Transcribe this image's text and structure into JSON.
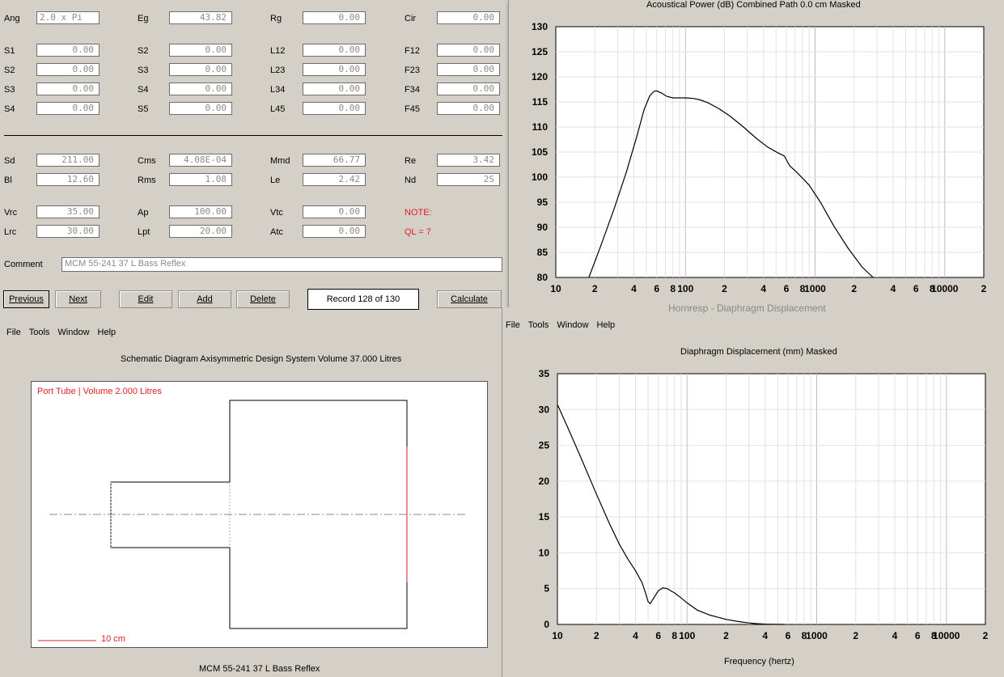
{
  "params": {
    "row0": [
      {
        "label": "Ang",
        "value": "2.0 x Pi"
      },
      {
        "label": "Eg",
        "value": "43.82"
      },
      {
        "label": "Rg",
        "value": "0.00"
      },
      {
        "label": "Cir",
        "value": "0.00"
      }
    ],
    "row1": [
      {
        "label": "S1",
        "value": "0.00"
      },
      {
        "label": "S2",
        "value": "0.00"
      },
      {
        "label": "L12",
        "value": "0.00"
      },
      {
        "label": "F12",
        "value": "0.00"
      }
    ],
    "row2": [
      {
        "label": "S2",
        "value": "0.00"
      },
      {
        "label": "S3",
        "value": "0.00"
      },
      {
        "label": "L23",
        "value": "0.00"
      },
      {
        "label": "F23",
        "value": "0.00"
      }
    ],
    "row3": [
      {
        "label": "S3",
        "value": "0.00"
      },
      {
        "label": "S4",
        "value": "0.00"
      },
      {
        "label": "L34",
        "value": "0.00"
      },
      {
        "label": "F34",
        "value": "0.00"
      }
    ],
    "row4": [
      {
        "label": "S4",
        "value": "0.00"
      },
      {
        "label": "S5",
        "value": "0.00"
      },
      {
        "label": "L45",
        "value": "0.00"
      },
      {
        "label": "F45",
        "value": "0.00"
      }
    ],
    "row5": [
      {
        "label": "Sd",
        "value": "211.00"
      },
      {
        "label": "Cms",
        "value": "4.08E-04"
      },
      {
        "label": "Mmd",
        "value": "66.77"
      },
      {
        "label": "Re",
        "value": "3.42"
      }
    ],
    "row6": [
      {
        "label": "Bl",
        "value": "12.60"
      },
      {
        "label": "Rms",
        "value": "1.08"
      },
      {
        "label": "Le",
        "value": "2.42"
      },
      {
        "label": "Nd",
        "value": "2S"
      }
    ],
    "row7": [
      {
        "label": "Vrc",
        "value": "35.00"
      },
      {
        "label": "Ap",
        "value": "100.00"
      },
      {
        "label": "Vtc",
        "value": "0.00"
      }
    ],
    "row8": [
      {
        "label": "Lrc",
        "value": "30.00"
      },
      {
        "label": "Lpt",
        "value": "20.00"
      },
      {
        "label": "Atc",
        "value": "0.00"
      }
    ],
    "note_label": "NOTE:",
    "note_value": "QL = 7",
    "comment_label": "Comment",
    "comment_value": "MCM  55-241 37 L Bass Reflex"
  },
  "buttons": {
    "previous": "Previous",
    "next": "Next",
    "edit": "Edit",
    "add": "Add",
    "delete": "Delete",
    "record": "Record 128 of 130",
    "calculate": "Calculate"
  },
  "menu": {
    "file": "File",
    "tools": "Tools",
    "window": "Window",
    "help": "Help"
  },
  "schematic": {
    "title": "Schematic Diagram   Axisymmetric Design   System Volume 37.000 Litres",
    "port_label": "Port Tube | Volume 2.000 Litres",
    "scale_label": "10 cm",
    "footer": "MCM  55-241 37 L Bass Reflex"
  },
  "power_plot": {
    "title": "Acoustical Power (dB)   Combined    Path 0.0 cm    Masked"
  },
  "disp_plot": {
    "title": "Diaphragm Displacement (mm)    Masked",
    "xlabel": "Frequency (hertz)",
    "bg_title": "Hornresp - Diaphragm Displacement"
  },
  "chart_data": [
    {
      "type": "line",
      "title": "Acoustical Power (dB)   Combined    Path 0.0 cm    Masked",
      "xscale": "log",
      "xlim": [
        10,
        20000
      ],
      "ylim": [
        80,
        130
      ],
      "yticks": [
        80,
        85,
        90,
        95,
        100,
        105,
        110,
        115,
        120,
        125,
        130
      ],
      "xtick_labels": [
        "10",
        "2",
        "4",
        "6",
        "8",
        "100",
        "2",
        "4",
        "6",
        "8",
        "1000",
        "2",
        "4",
        "6",
        "8",
        "10000",
        "2"
      ],
      "series": [
        {
          "x": [
            18,
            22,
            28,
            35,
            42,
            48,
            53,
            57,
            60,
            65,
            72,
            80,
            90,
            100,
            115,
            130,
            150,
            180,
            220,
            280,
            350,
            430,
            520,
            580,
            620,
            640,
            660,
            700,
            780,
            900,
            1100,
            1400,
            1800,
            2300,
            2800
          ],
          "y": [
            80,
            86,
            93.5,
            101,
            108,
            113.5,
            116.2,
            117.1,
            117.2,
            116.8,
            116.1,
            115.8,
            115.8,
            115.8,
            115.7,
            115.4,
            114.8,
            113.7,
            112.2,
            110,
            107.8,
            106,
            104.8,
            104.2,
            102.8,
            102.2,
            101.9,
            101.3,
            100.1,
            98.4,
            95,
            90.2,
            85.8,
            82.1,
            80
          ]
        }
      ]
    },
    {
      "type": "line",
      "title": "Diaphragm Displacement (mm)    Masked",
      "xlabel": "Frequency (hertz)",
      "xscale": "log",
      "xlim": [
        10,
        20000
      ],
      "ylim": [
        0,
        35
      ],
      "yticks": [
        0,
        5,
        10,
        15,
        20,
        25,
        30,
        35
      ],
      "xtick_labels": [
        "10",
        "2",
        "4",
        "6",
        "8",
        "100",
        "2",
        "4",
        "6",
        "8",
        "1000",
        "2",
        "4",
        "6",
        "8",
        "10000",
        "2"
      ],
      "series": [
        {
          "x": [
            10,
            12,
            15,
            20,
            25,
            30,
            35,
            40,
            45,
            48,
            50,
            52,
            55,
            60,
            65,
            70,
            80,
            90,
            100,
            120,
            150,
            200,
            250,
            300,
            350,
            400,
            450,
            500,
            560
          ],
          "y": [
            30.7,
            27.5,
            23.5,
            18.2,
            14.2,
            11.2,
            9.1,
            7.5,
            5.8,
            4.3,
            3.2,
            2.9,
            3.6,
            4.7,
            5.1,
            5.0,
            4.4,
            3.7,
            3.0,
            2.0,
            1.3,
            0.7,
            0.4,
            0.2,
            0.1,
            0.05,
            0.02,
            0.01,
            0.0
          ]
        }
      ]
    }
  ]
}
